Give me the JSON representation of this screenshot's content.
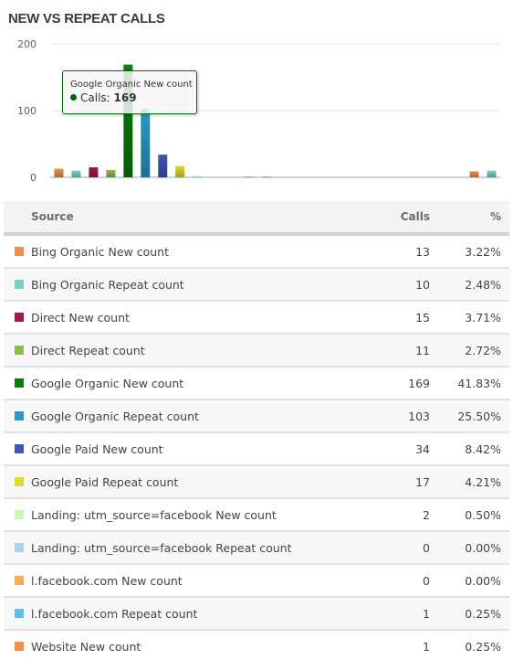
{
  "title": "NEW VS REPEAT CALLS",
  "chart_data": {
    "type": "bar",
    "title": "NEW VS REPEAT CALLS",
    "xlabel": "",
    "ylabel": "",
    "ylim": [
      0,
      200
    ],
    "yticks": [
      "0",
      "100",
      "200"
    ],
    "grid": true,
    "categories": [
      "Bing Organic New count",
      "Bing Organic Repeat count",
      "Direct New count",
      "Direct Repeat count",
      "Google Organic New count",
      "Google Organic Repeat count",
      "Google Paid New count",
      "Google Paid Repeat count",
      "Landing: utm_source=facebook New count",
      "Landing: utm_source=facebook Repeat count",
      "l.facebook.com New count",
      "l.facebook.com Repeat count",
      "Website New count",
      "",
      "",
      "",
      "",
      "",
      "",
      "",
      "",
      "",
      "",
      "",
      "",
      ""
    ],
    "values": [
      13,
      10,
      15,
      11,
      169,
      103,
      34,
      17,
      2,
      0,
      0,
      1,
      1,
      0,
      0,
      0,
      0,
      0,
      0,
      0,
      0,
      0,
      0,
      0,
      9,
      10
    ],
    "colors": [
      "#ef8f4a",
      "#7ccfc3",
      "#a3174c",
      "#8dbc54",
      "#0b7f0b",
      "#2a9ac9",
      "#3f55b8",
      "#e0da2a",
      "#c9f7b8",
      "#a9d1e8",
      "#fbaa55",
      "#5bbfe6",
      "#ef8f4a",
      "#ffffff",
      "#ffffff",
      "#ffffff",
      "#ffffff",
      "#ffffff",
      "#ffffff",
      "#ffffff",
      "#ffffff",
      "#ffffff",
      "#ffffff",
      "#ffffff",
      "#ef8f4a",
      "#7ccfc3"
    ],
    "tooltip": {
      "series": "Google Organic New count",
      "label": "Calls:",
      "value": "169"
    }
  },
  "table": {
    "headers": {
      "source": "Source",
      "calls": "Calls",
      "pct": "%"
    },
    "rows": [
      {
        "source": "Bing Organic New count",
        "calls": "13",
        "pct": "3.22%",
        "color": "#ef8f4a"
      },
      {
        "source": "Bing Organic Repeat count",
        "calls": "10",
        "pct": "2.48%",
        "color": "#7ccfc3"
      },
      {
        "source": "Direct New count",
        "calls": "15",
        "pct": "3.71%",
        "color": "#a3174c"
      },
      {
        "source": "Direct Repeat count",
        "calls": "11",
        "pct": "2.72%",
        "color": "#8dbc54"
      },
      {
        "source": "Google Organic New count",
        "calls": "169",
        "pct": "41.83%",
        "color": "#0b7f0b"
      },
      {
        "source": "Google Organic Repeat count",
        "calls": "103",
        "pct": "25.50%",
        "color": "#2a9ac9"
      },
      {
        "source": "Google Paid New count",
        "calls": "34",
        "pct": "8.42%",
        "color": "#3f55b8"
      },
      {
        "source": "Google Paid Repeat count",
        "calls": "17",
        "pct": "4.21%",
        "color": "#e0da2a"
      },
      {
        "source": "Landing: utm_source=facebook New count",
        "calls": "2",
        "pct": "0.50%",
        "color": "#c9f7b8"
      },
      {
        "source": "Landing: utm_source=facebook Repeat count",
        "calls": "0",
        "pct": "0.00%",
        "color": "#a9d1e8"
      },
      {
        "source": "l.facebook.com New count",
        "calls": "0",
        "pct": "0.00%",
        "color": "#fbaa55"
      },
      {
        "source": "l.facebook.com Repeat count",
        "calls": "1",
        "pct": "0.25%",
        "color": "#5bbfe6"
      },
      {
        "source": "Website New count",
        "calls": "1",
        "pct": "0.25%",
        "color": "#ef8f4a"
      }
    ]
  }
}
